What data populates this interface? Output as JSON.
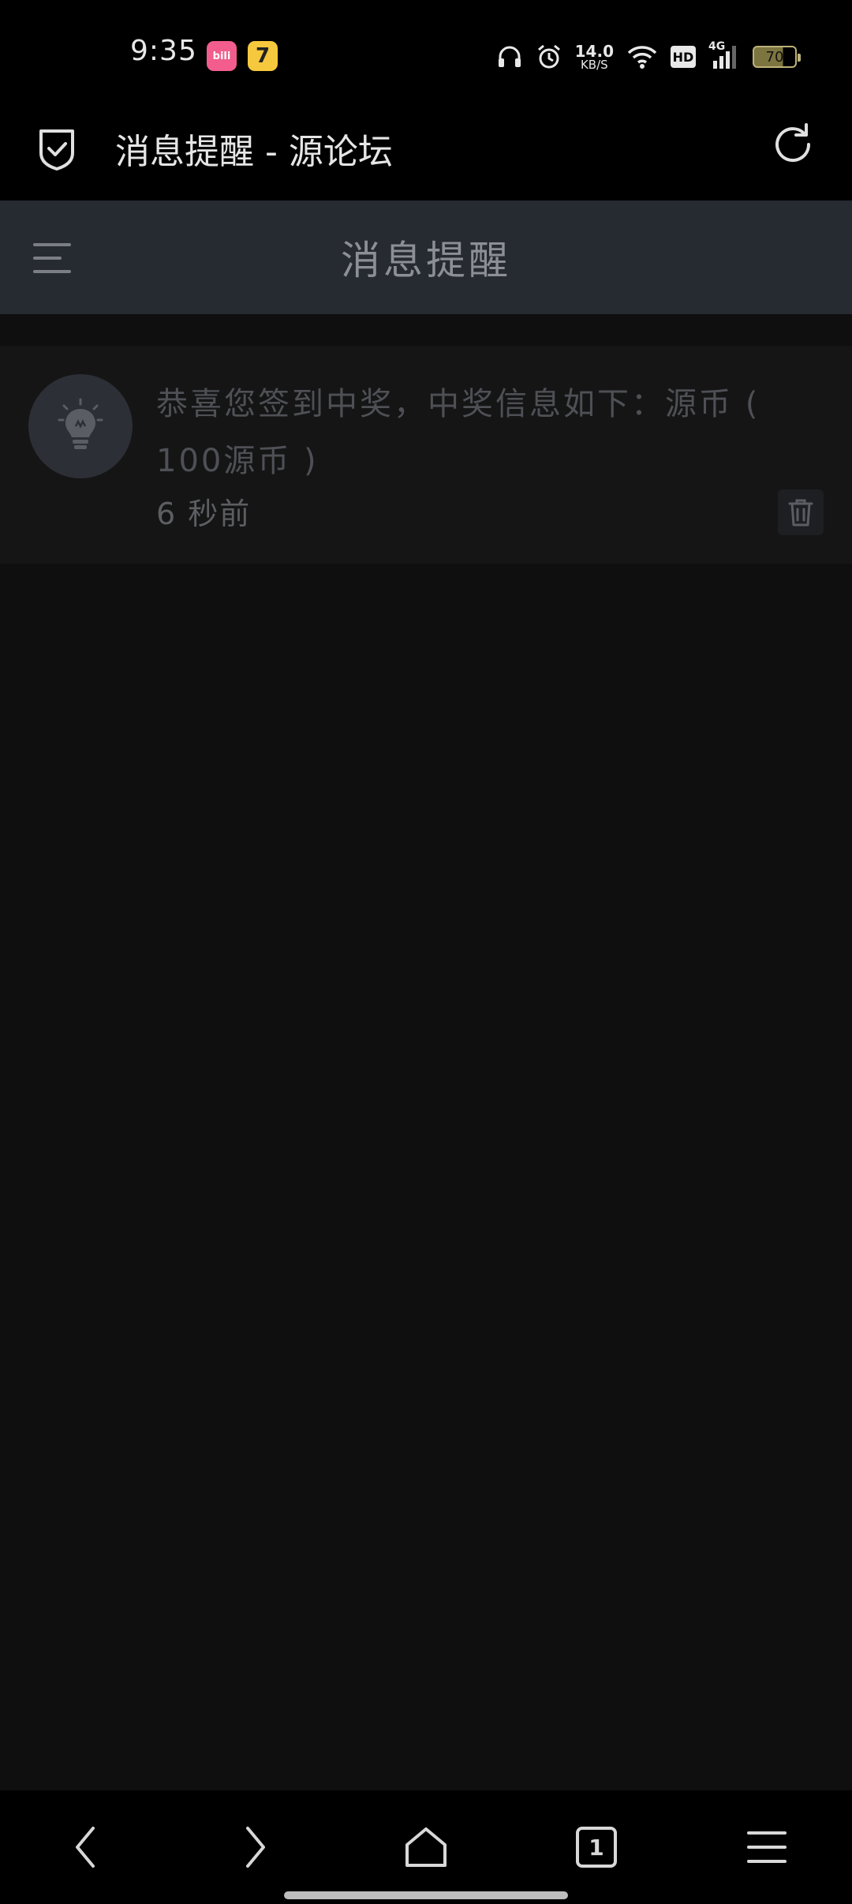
{
  "status_bar": {
    "time": "9:35",
    "apps": [
      {
        "name": "bilibili",
        "label": "bili"
      },
      {
        "name": "seven",
        "label": "7"
      }
    ],
    "net_speed_value": "14.0",
    "net_speed_unit": "KB/S",
    "hd_label": "HD",
    "network_label": "4G",
    "battery_level": "70"
  },
  "browser_bar": {
    "title": "消息提醒 - 源论坛"
  },
  "site_header": {
    "title": "消息提醒"
  },
  "notifications": [
    {
      "text": "恭喜您签到中奖，中奖信息如下：源币 ( 100源币 )",
      "time": "6 秒前"
    }
  ],
  "bottom_nav": {
    "tab_count": "1"
  },
  "colors": {
    "background": "#0f0f10",
    "header": "#262a31",
    "card": "#151516"
  }
}
